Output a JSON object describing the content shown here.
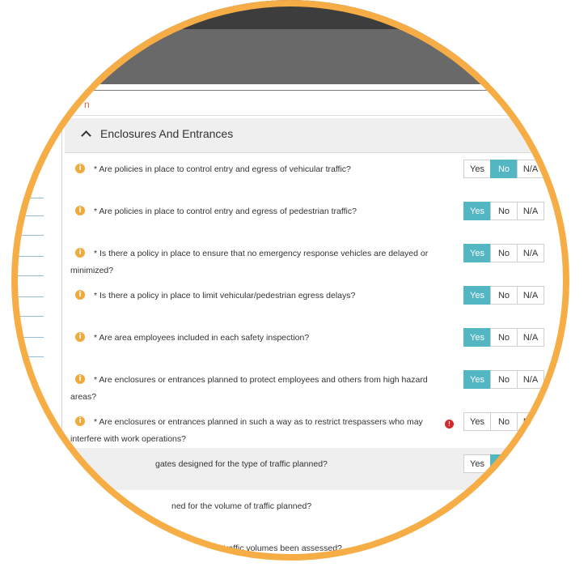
{
  "input": {
    "partial_label": "n"
  },
  "section": {
    "title": "Enclosures And Entrances"
  },
  "options": [
    "Yes",
    "No",
    "N/A"
  ],
  "questions": [
    {
      "text": "* Are policies in place to control entry and egress of vehicular traffic?",
      "selected": "No"
    },
    {
      "text": "* Are policies in place to control entry and egress of pedestrian traffic?",
      "selected": "Yes"
    },
    {
      "text": "* Is there a policy in place to ensure that no emergency response vehicles are delayed or minimized?",
      "selected": "Yes"
    },
    {
      "text": "* Is there a policy in place to limit vehicular/pedestrian egress delays?",
      "selected": "Yes"
    },
    {
      "text": "* Are area employees included in each safety inspection?",
      "selected": "Yes"
    },
    {
      "text": "* Are enclosures or entrances planned to protect employees and others from high hazard areas?",
      "selected": "Yes"
    },
    {
      "text": "* Are enclosures or entrances planned in such a way as to restrict trespassers who may interfere with work operations?",
      "selected": "",
      "warning": true
    },
    {
      "text": "gates designed for the type of traffic planned?",
      "selected": "No"
    },
    {
      "text": "ned for the volume of traffic planned?",
      "selected": "",
      "warning": true
    },
    {
      "text": "traffic volumes been assessed?",
      "selected": ""
    }
  ],
  "colors": {
    "accent": "#53b6c3",
    "ring": "#f7ad45",
    "info": "#f0a93b",
    "warning": "#d42a2a"
  },
  "icons": {
    "info": "info-icon",
    "warning": "warning-icon",
    "collapse": "chevron-up-icon"
  }
}
